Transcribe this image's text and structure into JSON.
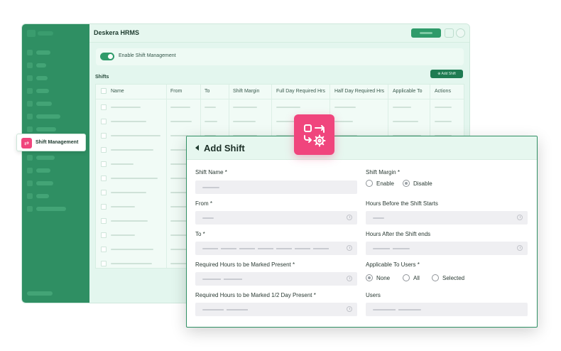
{
  "app": {
    "title": "Deskera HRMS",
    "enable_shift_label": "Enable Shift Management",
    "enable_shift_on": true,
    "shifts_title": "Shifts",
    "add_shift_button": "⊕ Add Shift",
    "table_headers": [
      "Name",
      "From",
      "To",
      "Shift Margin",
      "Full Day Required Hrs",
      "Half Day Required Hrs",
      "Applicable To",
      "Actions"
    ]
  },
  "sidebar": {
    "active_item": {
      "label": "Shift Management",
      "icon": "shift-management-icon"
    }
  },
  "modal": {
    "title": "Add Shift",
    "fields": {
      "shift_name_label": "Shift Name *",
      "shift_margin_label": "Shift Margin *",
      "shift_margin_options": [
        "Enable",
        "Disable"
      ],
      "shift_margin_selected": "Disable",
      "from_label": "From *",
      "hours_before_label": "Hours Before the Shift Starts",
      "to_label": "To *",
      "hours_after_label": "Hours After the Shift ends",
      "required_present_label": "Required Hours to be Marked Present *",
      "applicable_users_label": "Applicable To Users *",
      "applicable_users_options": [
        "None",
        "All",
        "Selected"
      ],
      "applicable_users_selected": "None",
      "required_half_label": "Required Hours to be Marked 1/2 Day Present *",
      "users_label": "Users"
    }
  },
  "colors": {
    "sidebar_green": "#2f8f63",
    "accent_pink": "#f0457d",
    "header_tint": "#e6f7ef"
  }
}
